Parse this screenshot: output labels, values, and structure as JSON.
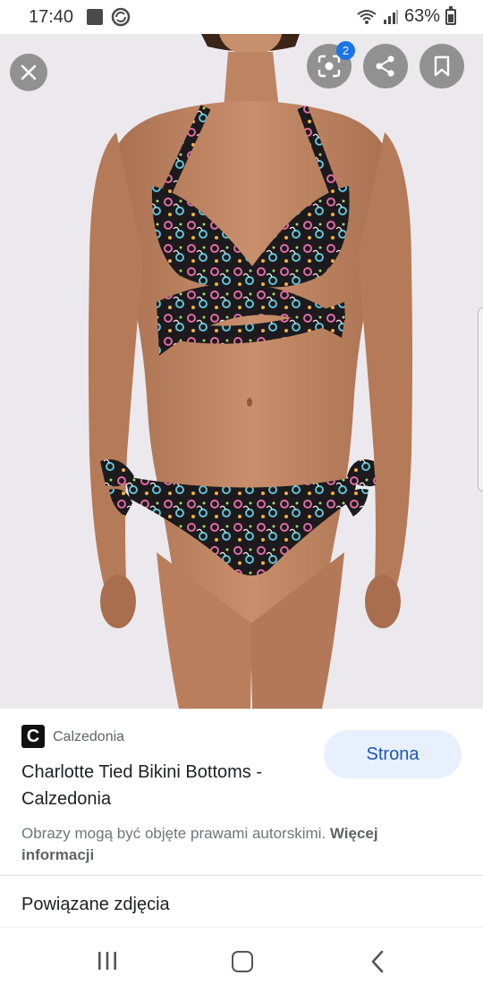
{
  "status_bar": {
    "time": "17:40",
    "battery": "63%",
    "battery_level": 0.63
  },
  "viewer": {
    "lens_badge_count": "2",
    "icons": [
      "close-icon",
      "lens-icon",
      "share-icon",
      "bookmark-icon"
    ]
  },
  "result": {
    "source_logo_letter": "C",
    "source_name": "Calzedonia",
    "title": "Charlotte Tied Bikini Bottoms - Calzedonia",
    "visit_label": "Strona",
    "copyright_text": "Obrazy mogą być objęte prawami autorskimi.",
    "more_info_label": "Więcej informacji"
  },
  "related_label": "Powiązane zdjęcia",
  "colors": {
    "accent": "#1a73e8",
    "visit_button_bg": "#e8f0fe",
    "photo_background": "#ebe9ee"
  }
}
